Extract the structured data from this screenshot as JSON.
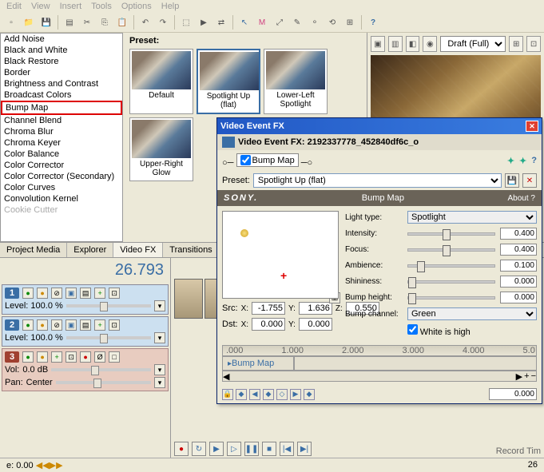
{
  "menu": {
    "items": [
      "Edit",
      "View",
      "Insert",
      "Tools",
      "Options",
      "Help"
    ]
  },
  "fx_list": [
    "Add Noise",
    "Black and White",
    "Black Restore",
    "Border",
    "Brightness and Contrast",
    "Broadcast Colors",
    "Bump Map",
    "Channel Blend",
    "Chroma Blur",
    "Chroma Keyer",
    "Color Balance",
    "Color Corrector",
    "Color Corrector (Secondary)",
    "Color Curves",
    "Convolution Kernel",
    "Cookie Cutter"
  ],
  "fx_list_selected": 6,
  "preset": {
    "label": "Preset:",
    "items": [
      "Default",
      "Spotlight Up (flat)",
      "Lower-Left Spotlight",
      "Upper-Right Glow"
    ],
    "selected": 1
  },
  "right_panel": {
    "quality": "Draft (Full)"
  },
  "tabs": [
    "Project Media",
    "Explorer",
    "Video FX",
    "Transitions",
    "M"
  ],
  "tabs_active": 2,
  "counter": "26.793",
  "track1": {
    "num": "1",
    "level": "Level: 100.0 %"
  },
  "track2": {
    "num": "2",
    "level": "Level: 100.0 %"
  },
  "track3": {
    "num": "3",
    "vol_lbl": "Vol:",
    "vol": "0.0 dB",
    "pan_lbl": "Pan:",
    "pan": "Center"
  },
  "time": {
    "label": "e:",
    "value": "0.00"
  },
  "status": {
    "rec": "Record Tim",
    "fps": "26"
  },
  "fx_dialog": {
    "title": "Video Event FX",
    "subtitle": "Video Event FX: 2192337778_452840df6c_o",
    "chain_node": "Bump Map",
    "preset_label": "Preset:",
    "preset_value": "Spotlight Up (flat)",
    "brand": "SONY.",
    "effect_name": "Bump Map",
    "about": "About  ?",
    "src_label": "Src:",
    "dst_label": "Dst:",
    "src": {
      "x": "-1.755",
      "y": "1.636",
      "z": "0.550"
    },
    "dst": {
      "x": "0.000",
      "y": "0.000"
    },
    "params": {
      "light_type_lbl": "Light type:",
      "light_type": "Spotlight",
      "intensity_lbl": "Intensity:",
      "intensity": "0.400",
      "focus_lbl": "Focus:",
      "focus": "0.400",
      "ambience_lbl": "Ambience:",
      "ambience": "0.100",
      "shininess_lbl": "Shininess:",
      "shininess": "0.000",
      "bump_height_lbl": "Bump height:",
      "bump_height": "0.000",
      "bump_channel_lbl": "Bump channel:",
      "bump_channel": "Green",
      "white_high": "White is high"
    },
    "timeline": {
      "ticks": [
        ".000",
        "1.000",
        "2.000",
        "3.000",
        "4.000",
        "5.0"
      ],
      "track": "Bump Map",
      "pos": "0.000"
    }
  }
}
